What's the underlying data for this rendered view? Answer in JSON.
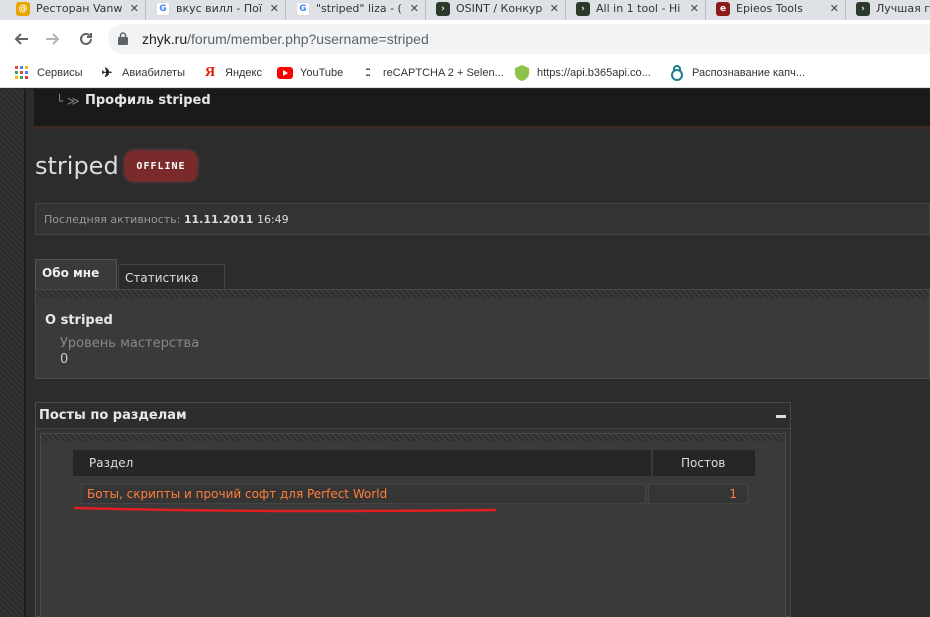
{
  "browser": {
    "tabs": [
      {
        "title": "Ресторан Vanw",
        "icon": "vanwok-icon",
        "color": "#e8a500"
      },
      {
        "title": "вкус вилл - Пої",
        "icon": "google-icon",
        "color": "#4285f4"
      },
      {
        "title": "\"striped\" liza - (",
        "icon": "google-icon",
        "color": "#4285f4"
      },
      {
        "title": "OSINT / Конкур",
        "icon": "codeby-icon",
        "color": "#2b3a2b"
      },
      {
        "title": "All in 1 tool - Hi",
        "icon": "codeby-icon",
        "color": "#2b3a2b"
      },
      {
        "title": "Epieos Tools",
        "icon": "epieos-icon",
        "color": "#8b1a1a"
      },
      {
        "title": "Лучшая г",
        "icon": "codeby-icon",
        "color": "#2b3a2b"
      }
    ],
    "url_host": "zhyk.ru",
    "url_path": "/forum/member.php?username=striped",
    "bookmarks": [
      {
        "label": "Сервисы",
        "icon": "apps-grid-icon"
      },
      {
        "label": "Авиабилеты",
        "icon": "plane-icon"
      },
      {
        "label": "Яндекс",
        "icon": "yandex-icon"
      },
      {
        "label": "YouTube",
        "icon": "youtube-icon"
      },
      {
        "label": "reCAPTCHA 2 + Selen...",
        "icon": "anticaptcha-icon"
      },
      {
        "label": "https://api.b365api.co...",
        "icon": "shield-icon"
      },
      {
        "label": "Распознавание капч...",
        "icon": "captcha-lock-icon"
      }
    ]
  },
  "page": {
    "breadcrumb_title": "Профиль striped",
    "username": "striped",
    "status_badge": "OFFLINE",
    "activity_label": "Последняя активность:",
    "activity_date": "11.11.2011",
    "activity_time": "16:49",
    "tabs": [
      {
        "label": "Обо мне",
        "active": true
      },
      {
        "label": "Статистика",
        "active": false
      }
    ],
    "about": {
      "title": "О striped",
      "field_label": "Уровень мастерства",
      "field_value": "0"
    },
    "posts": {
      "title": "Посты по разделам",
      "columns": [
        "Раздел",
        "Постов"
      ],
      "rows": [
        {
          "section": "Боты, скрипты и прочий софт для Perfect World",
          "count": "1"
        }
      ]
    }
  },
  "colors": {
    "accent_link": "#ff7f3a",
    "annotation_red": "#e02020",
    "badge": "#7a2a2a"
  }
}
